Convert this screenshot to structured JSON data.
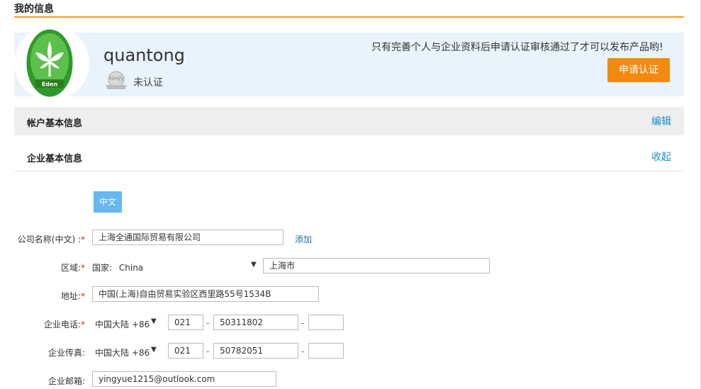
{
  "page": {
    "title": "我的信息"
  },
  "profile": {
    "username": "quantong",
    "verify_status": "未认证",
    "notice": "只有完善个人与企业资料后申请认证审核通过了才可以发布产品哟!",
    "apply_label": "申请认证",
    "avatar_icon": "eden-lily-logo-icon",
    "badge_icon": "verify-seal-icon"
  },
  "sections": {
    "account": {
      "label": "帐户基本信息",
      "action": "编辑"
    },
    "company": {
      "label": "企业基本信息",
      "action": "收起"
    }
  },
  "lang_tab": "中文",
  "form": {
    "company_name": {
      "label": "公司名称(中文) :",
      "required": "*",
      "value": "上海全通国际贸易有限公司",
      "add_link": "添加"
    },
    "region": {
      "label": "区域:",
      "required": "*",
      "country_prefix": "国家:",
      "country": "China",
      "city": "上海市"
    },
    "address": {
      "label": "地址:",
      "required": "*",
      "value": "中国(上海)自由贸易实验区西里路55号1534B"
    },
    "phone": {
      "label": "企业电话:",
      "required": "*",
      "country_code": "中国大陆 +86",
      "area": "021",
      "number": "50311802",
      "ext": ""
    },
    "fax": {
      "label": "企业传真:",
      "country_code": "中国大陆 +86",
      "area": "021",
      "number": "50782051",
      "ext": ""
    },
    "email": {
      "label": "企业邮箱:",
      "value": "yingyue1215@outlook.com"
    },
    "dash": "-",
    "caret": "▼"
  },
  "colors": {
    "accent": "#f38a0f",
    "link": "#1a8fc9",
    "banner": "#e9f3fc",
    "tab": "#66b8f0"
  }
}
